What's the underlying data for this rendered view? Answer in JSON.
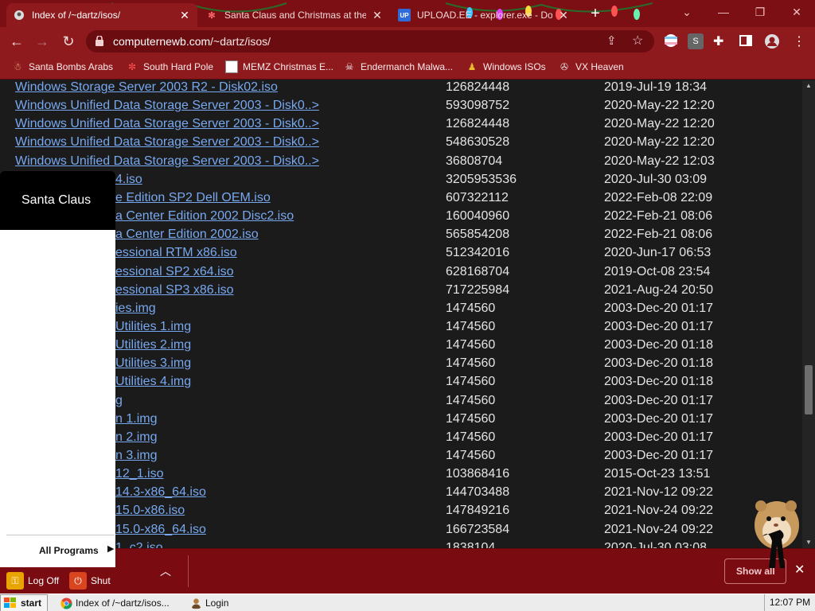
{
  "browser": {
    "tabs": [
      {
        "title": "Index of /~dartz/isos/",
        "active": true
      },
      {
        "title": "Santa Claus and Christmas at the",
        "active": false
      },
      {
        "title": "UPLOAD.EE - explorer.exe - Dow",
        "active": false
      }
    ],
    "url_host": "computernewb.com",
    "url_path": "/~dartz/isos/",
    "ext_label": "S",
    "bookmarks": [
      {
        "label": "Santa Bombs Arabs",
        "icon": "santa-icon"
      },
      {
        "label": "South Hard Pole",
        "icon": "snowflake-icon"
      },
      {
        "label": "MEMZ Christmas E...",
        "icon": "memz-icon"
      },
      {
        "label": "Endermanch Malwa...",
        "icon": "skull-icon"
      },
      {
        "label": "Windows ISOs",
        "icon": "character-icon"
      },
      {
        "label": "VX Heaven",
        "icon": "vx-icon"
      }
    ]
  },
  "listing": [
    {
      "name": "Windows Storage Server 2003 R2 - Disk02.iso",
      "size": "126824448",
      "date": "2019-Jul-19 18:34"
    },
    {
      "name": "Windows Unified Data Storage Server 2003 - Disk0..>",
      "size": "593098752",
      "date": "2020-May-22 12:20"
    },
    {
      "name": "Windows Unified Data Storage Server 2003 - Disk0..>",
      "size": "126824448",
      "date": "2020-May-22 12:20"
    },
    {
      "name": "Windows Unified Data Storage Server 2003 - Disk0..>",
      "size": "548630528",
      "date": "2020-May-22 12:20"
    },
    {
      "name": "Windows Unified Data Storage Server 2003 - Disk0..>",
      "size": "36808704",
      "date": "2020-May-22 12:03"
    },
    {
      "name": "4.iso",
      "size": "3205953536",
      "date": "2020-Jul-30 03:09"
    },
    {
      "name": "e Edition SP2 Dell OEM.iso",
      "size": "607322112",
      "date": "2022-Feb-08 22:09"
    },
    {
      "name": "a Center Edition 2002 Disc2.iso",
      "size": "160040960",
      "date": "2022-Feb-21 08:06"
    },
    {
      "name": "a Center Edition 2002.iso",
      "size": "565854208",
      "date": "2022-Feb-21 08:06"
    },
    {
      "name": "essional RTM x86.iso",
      "size": "512342016",
      "date": "2020-Jun-17 06:53"
    },
    {
      "name": "essional SP2 x64.iso",
      "size": "628168704",
      "date": "2019-Oct-08 23:54"
    },
    {
      "name": "essional SP3 x86.iso",
      "size": "717225984",
      "date": "2021-Aug-24 20:50"
    },
    {
      "name": "ies.img",
      "size": "1474560",
      "date": "2003-Dec-20 01:17"
    },
    {
      "name": "Utilities 1.img",
      "size": "1474560",
      "date": "2003-Dec-20 01:17"
    },
    {
      "name": "Utilities 2.img",
      "size": "1474560",
      "date": "2003-Dec-20 01:18"
    },
    {
      "name": "Utilities 3.img",
      "size": "1474560",
      "date": "2003-Dec-20 01:18"
    },
    {
      "name": "Utilities 4.img",
      "size": "1474560",
      "date": "2003-Dec-20 01:18"
    },
    {
      "name": "g",
      "size": "1474560",
      "date": "2003-Dec-20 01:17"
    },
    {
      "name": "n 1.img",
      "size": "1474560",
      "date": "2003-Dec-20 01:17"
    },
    {
      "name": "n 2.img",
      "size": "1474560",
      "date": "2003-Dec-20 01:17"
    },
    {
      "name": "n 3.img",
      "size": "1474560",
      "date": "2003-Dec-20 01:17"
    },
    {
      "name": "12_1.iso",
      "size": "103868416",
      "date": "2015-Oct-23 13:51"
    },
    {
      "name": "14.3-x86_64.iso",
      "size": "144703488",
      "date": "2021-Nov-12 09:22"
    },
    {
      "name": "15.0-x86.iso",
      "size": "147849216",
      "date": "2021-Nov-24 09:22"
    },
    {
      "name": "15.0-x86_64.iso",
      "size": "166723584",
      "date": "2021-Nov-24 09:22"
    },
    {
      "name": "1_c2.iso",
      "size": "1838104",
      "date": "2020-Jul-30 03:08"
    }
  ],
  "start_menu": {
    "user_name": "Santa Claus",
    "all_programs": "All Programs",
    "log_off": "Log Off",
    "shut_down": "Shut"
  },
  "download_bar": {
    "show_all": "Show all"
  },
  "taskbar": {
    "start": "start",
    "tasks": [
      {
        "label": "Index of /~dartz/isos...",
        "icon": "chrome-icon"
      },
      {
        "label": "Login",
        "icon": "user-icon"
      }
    ],
    "clock": "12:07 PM"
  },
  "colors": {
    "chrome_bg": "#8e1a1e",
    "tabstrip_bg": "#7b0f14",
    "page_bg": "#1b1b1b",
    "link": "#78a8f0",
    "text": "#e4e4e4"
  }
}
